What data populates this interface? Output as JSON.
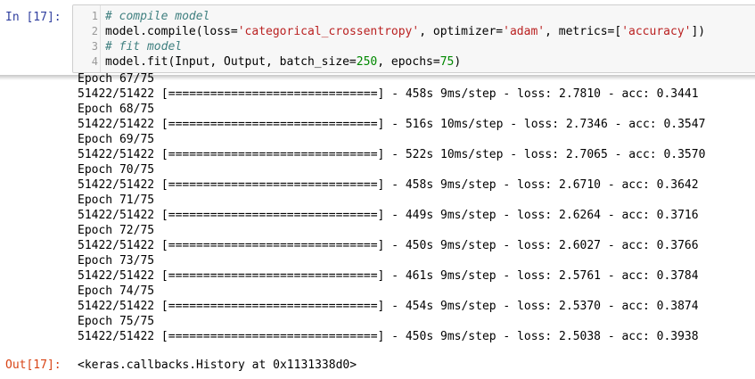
{
  "input_cell": {
    "prompt": "In [17]:",
    "lines": [
      {
        "number": "1",
        "segments": [
          {
            "text": "# compile model",
            "cls": "cm"
          }
        ]
      },
      {
        "number": "2",
        "segments": [
          {
            "text": "model.compile(loss=",
            "cls": ""
          },
          {
            "text": "'categorical_crossentropy'",
            "cls": "st"
          },
          {
            "text": ", optimizer=",
            "cls": ""
          },
          {
            "text": "'adam'",
            "cls": "st"
          },
          {
            "text": ", metrics=[",
            "cls": ""
          },
          {
            "text": "'accuracy'",
            "cls": "st"
          },
          {
            "text": "])",
            "cls": ""
          }
        ]
      },
      {
        "number": "3",
        "segments": [
          {
            "text": "# fit model",
            "cls": "cm"
          }
        ]
      },
      {
        "number": "4",
        "segments": [
          {
            "text": "model.fit(Input, Output, batch_size=",
            "cls": ""
          },
          {
            "text": "250",
            "cls": "nu"
          },
          {
            "text": ", epochs=",
            "cls": ""
          },
          {
            "text": "75",
            "cls": "nu"
          },
          {
            "text": ")",
            "cls": ""
          }
        ]
      }
    ]
  },
  "output": {
    "lines": [
      "Epoch 67/75",
      "51422/51422 [==============================] - 458s 9ms/step - loss: 2.7810 - acc: 0.3441",
      "Epoch 68/75",
      "51422/51422 [==============================] - 516s 10ms/step - loss: 2.7346 - acc: 0.3547",
      "Epoch 69/75",
      "51422/51422 [==============================] - 522s 10ms/step - loss: 2.7065 - acc: 0.3570",
      "Epoch 70/75",
      "51422/51422 [==============================] - 458s 9ms/step - loss: 2.6710 - acc: 0.3642",
      "Epoch 71/75",
      "51422/51422 [==============================] - 449s 9ms/step - loss: 2.6264 - acc: 0.3716",
      "Epoch 72/75",
      "51422/51422 [==============================] - 450s 9ms/step - loss: 2.6027 - acc: 0.3766",
      "Epoch 73/75",
      "51422/51422 [==============================] - 461s 9ms/step - loss: 2.5761 - acc: 0.3784",
      "Epoch 74/75",
      "51422/51422 [==============================] - 454s 9ms/step - loss: 2.5370 - acc: 0.3874",
      "Epoch 75/75",
      "51422/51422 [==============================] - 450s 9ms/step - loss: 2.5038 - acc: 0.3938"
    ]
  },
  "result": {
    "prompt": "Out[17]:",
    "value": "<keras.callbacks.History at 0x1131338d0>"
  }
}
